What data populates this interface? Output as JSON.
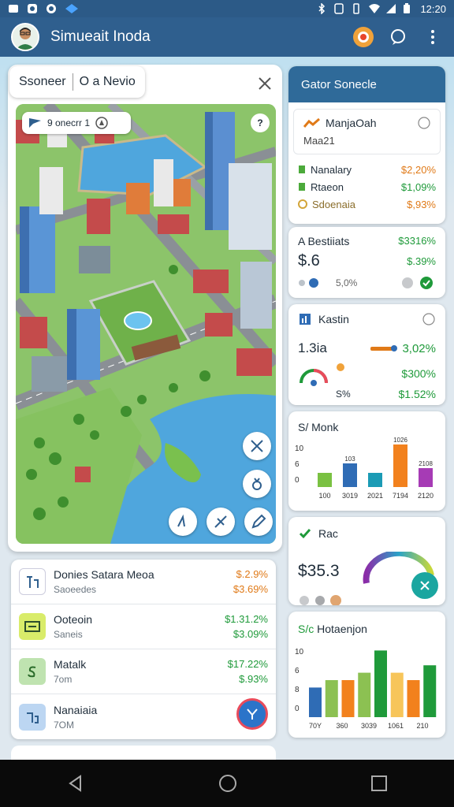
{
  "status_bar": {
    "time": "12:20"
  },
  "app_bar": {
    "title": "Simueait Inoda"
  },
  "search": {
    "left_text": "Ssoneer",
    "right_text": "O a Nevio"
  },
  "map": {
    "chip_text": "9 onecrr 1"
  },
  "list": {
    "items": [
      {
        "title": "Donies Satara Meoa",
        "subtitle": "Saoeedes",
        "value1": "$.2.9%",
        "value2": "$3.69%",
        "icon": "document-icon",
        "icon_color": "#ffffff",
        "val_color": "#e07a18"
      },
      {
        "title": "Ooteoin",
        "subtitle": "Saneis",
        "value1": "$1.31.2%",
        "value2": "$3.09%",
        "icon": "cash-icon",
        "icon_color": "#d9ec6a",
        "val_color": "#1f9a3a"
      },
      {
        "title": "Matalk",
        "subtitle": "7om",
        "value1": "$17.22%",
        "value2": "$.93%",
        "icon": "money-icon",
        "icon_color": "#bfe3b0",
        "val_color": "#1f9a3a"
      },
      {
        "title": "Nanaiaia",
        "subtitle": "7OM",
        "value1": "",
        "value2": "",
        "icon": "grid-icon",
        "icon_color": "#bcd6f2",
        "val_color": "#1f9a3a"
      }
    ]
  },
  "panel": {
    "header": "Gator Sonecle",
    "card1": {
      "title": "ManjaOah",
      "subtitle": "Maa21",
      "rows": [
        {
          "label": "Nanalary",
          "value": "$2,20%",
          "color": "#e07a18"
        },
        {
          "label": "Rtaeon",
          "value": "$1,09%",
          "color": "#1f9a3a"
        },
        {
          "label": "Sdoenaia",
          "value": "$,93%",
          "color": "#e07a18"
        }
      ]
    },
    "card2": {
      "title": "A Bestiiats",
      "big": "$.6",
      "v1": "$3316%",
      "v2": "$.39%",
      "pct": "5,0%"
    },
    "card3": {
      "title": "Kastin",
      "big": "1.3ia",
      "v1": "3,02%",
      "v2": "$300%",
      "v3": "$1.52%",
      "small": "S%"
    },
    "card4": {
      "title": "Monk",
      "prefix": "S/"
    },
    "card5": {
      "title": "Rac",
      "big": "$35.3"
    },
    "card6": {
      "title": "Hotaenjon",
      "prefix": "S/c"
    }
  },
  "chart_data": [
    {
      "type": "bar",
      "title": "",
      "categories": [
        "100",
        "3019",
        "2021",
        "7194",
        "2120"
      ],
      "y_ticks": [
        "10",
        "6",
        "0"
      ],
      "bar_labels": [
        "",
        "103",
        "",
        "1026",
        "2108"
      ],
      "values": [
        3,
        5,
        3,
        9,
        4
      ],
      "colors": [
        "#7ac142",
        "#2f6cb5",
        "#1b9bb5",
        "#f2811d",
        "#a63bb5"
      ]
    },
    {
      "type": "bar",
      "title": "",
      "categories": [
        "70Y",
        "360",
        "3039",
        "1061",
        "210"
      ],
      "y_ticks": [
        "10",
        "6",
        "8",
        "0"
      ],
      "values": [
        4,
        5,
        5,
        6,
        9,
        6,
        5,
        7
      ],
      "colors": [
        "#2f6cb5",
        "#8cc152",
        "#f2811d",
        "#8cc152",
        "#1f9a3a",
        "#f7c55a",
        "#f2811d",
        "#1f9a3a"
      ]
    }
  ]
}
